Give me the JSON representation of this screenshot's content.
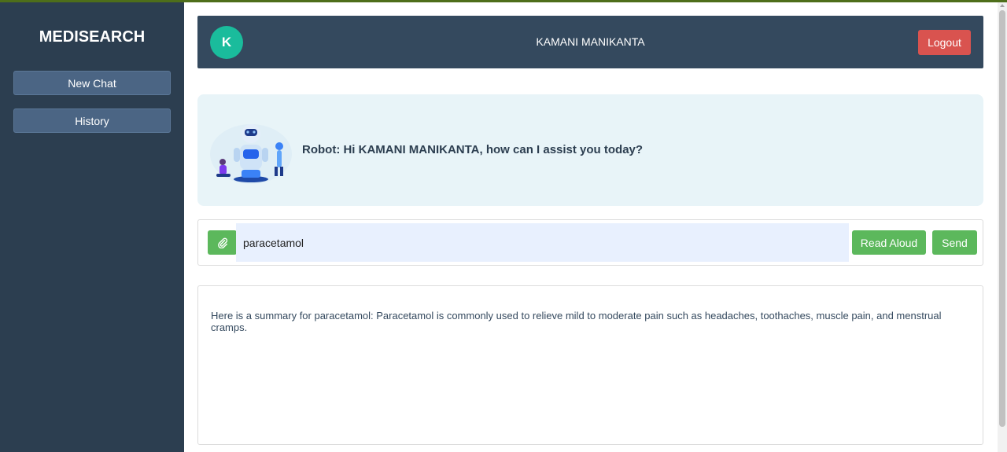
{
  "sidebar": {
    "brand": "MEDISEARCH",
    "buttons": [
      {
        "label": "New Chat"
      },
      {
        "label": "History"
      }
    ]
  },
  "header": {
    "avatar_letter": "K",
    "username": "KAMANI MANIKANTA",
    "logout_label": "Logout"
  },
  "greeting": {
    "text": "Robot: Hi KAMANI MANIKANTA, how can I assist you today?"
  },
  "input": {
    "value": "paracetamol",
    "attach_icon": "paperclip-icon",
    "read_aloud_label": "Read Aloud",
    "send_label": "Send"
  },
  "response": {
    "text": "Here is a summary for paracetamol: Paracetamol is commonly used to relieve mild to moderate pain such as headaches, toothaches, muscle pain, and menstrual cramps."
  },
  "colors": {
    "sidebar": "#2c3e50",
    "header": "#34495e",
    "accent_green": "#5cb85c",
    "logout_red": "#d9534f",
    "avatar": "#1abc9c"
  }
}
